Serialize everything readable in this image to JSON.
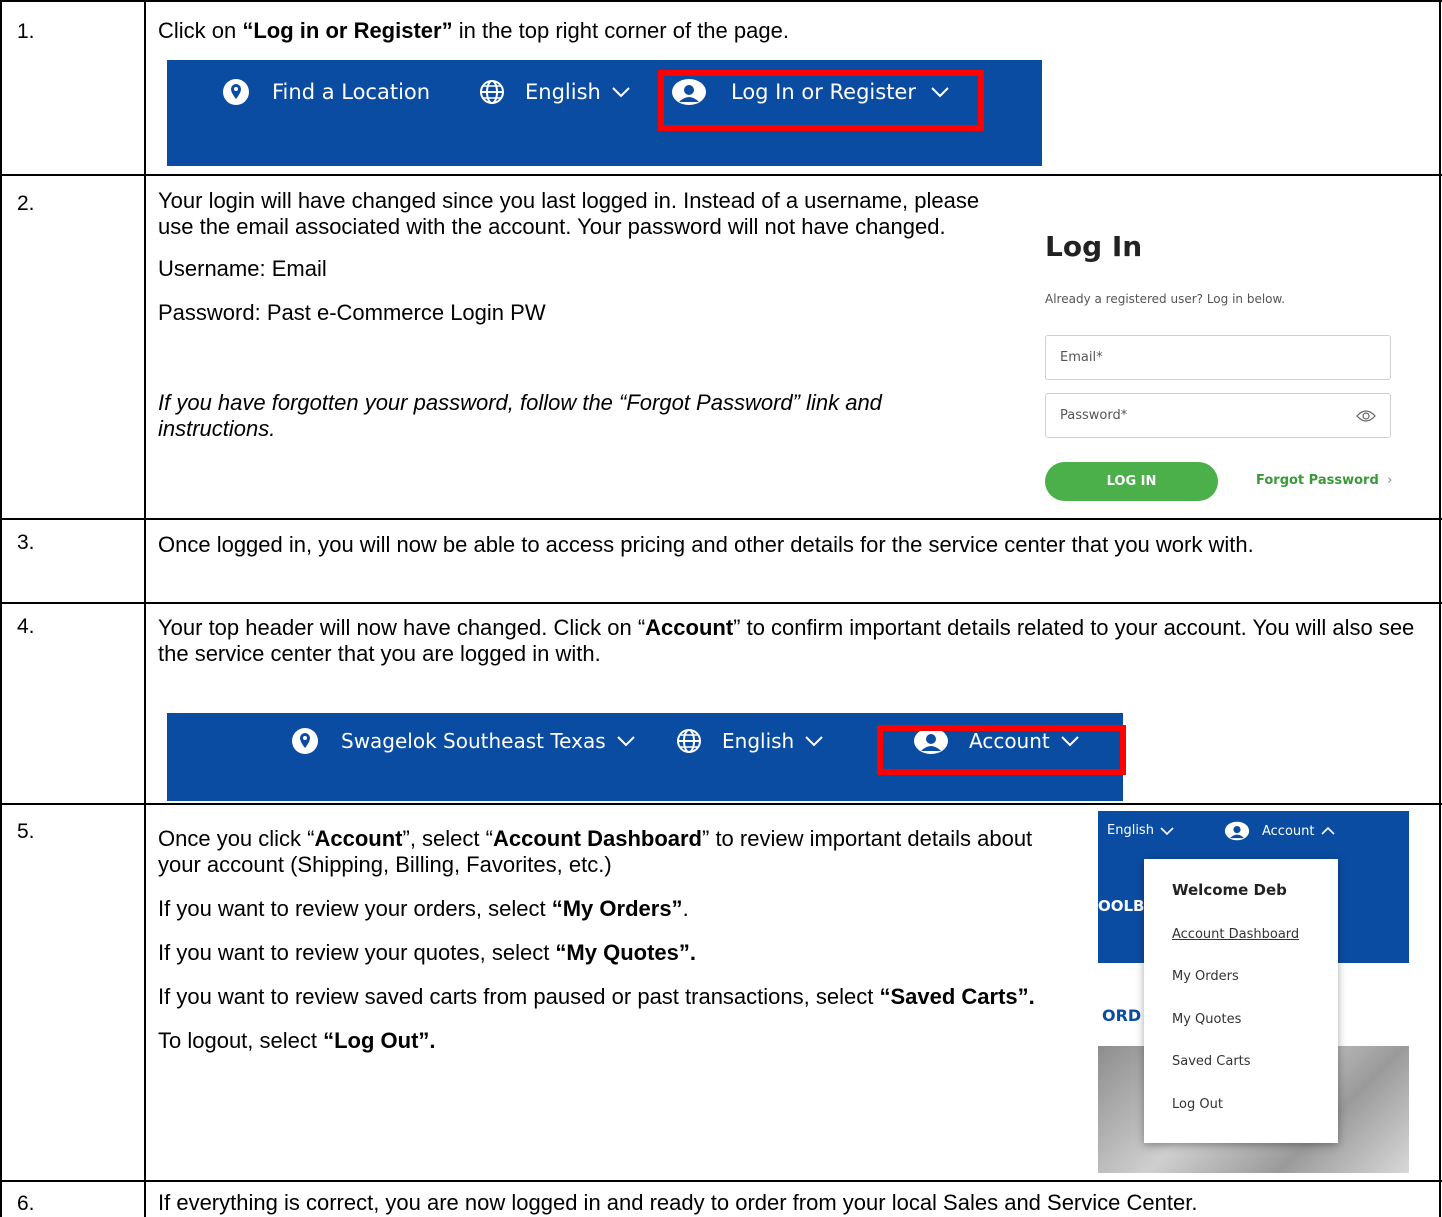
{
  "steps": [
    {
      "number": "1."
    },
    {
      "number": "2."
    },
    {
      "number": "3."
    },
    {
      "number": "4."
    },
    {
      "number": "5."
    },
    {
      "number": "6."
    }
  ],
  "step1": {
    "text_pre": "Click on ",
    "text_bold": "“Log in or Register”",
    "text_post": " in the top right corner of the page.",
    "nav": {
      "find_location": "Find a Location",
      "language": "English",
      "login": "Log In or Register"
    }
  },
  "step2": {
    "para1": "Your login will have changed since you last logged in. Instead of a username, please use the email associated with the account. Your password will not have changed.",
    "username_line": "Username: Email",
    "password_line": "Password: Past e-Commerce Login PW",
    "forgot_note": "If you have forgotten your password, follow the “Forgot Password” link and instructions.",
    "login_form": {
      "title": "Log In",
      "subtitle": "Already a registered user? Log in below.",
      "email_placeholder": "Email*",
      "password_placeholder": "Password*",
      "login_button": "LOG IN",
      "forgot_link": "Forgot Password",
      "accent_color": "#4bb04a",
      "link_color": "#3a9a3a"
    }
  },
  "step3": {
    "text": "Once logged in, you will now be able to access pricing and other details for the service center that you work with."
  },
  "step4": {
    "text_pre": "Your top header will now have changed. Click on “",
    "text_bold": "Account",
    "text_post": "” to confirm important details related to your account. You will also see the service center that you are logged in with.",
    "nav": {
      "location": "Swagelok Southeast Texas",
      "language": "English",
      "account": "Account"
    }
  },
  "step5": {
    "line1_pre": "Once you click “",
    "line1_bold1": "Account",
    "line1_mid": "”, select “",
    "line1_bold2": "Account Dashboard",
    "line1_post": "” to review important details about your account (Shipping, Billing, Favorites, etc.)",
    "orders_pre": "If you want to review your orders, select ",
    "orders_bold": "“My Orders”",
    "orders_post": ".",
    "quotes_pre": "If you want to review your quotes, select ",
    "quotes_bold": "“My Quotes”.",
    "carts_pre": "If you want to review saved carts from paused or past transactions, select ",
    "carts_bold": "“Saved Carts”.",
    "logout_pre": "To logout, select ",
    "logout_bold": "“Log Out”.",
    "menu": {
      "language": "English",
      "account": "Account",
      "welcome": "Welcome Deb",
      "items": [
        "Account Dashboard",
        "My Orders",
        "My Quotes",
        "Saved Carts",
        "Log Out"
      ],
      "bg_fragment_1": "OOLB",
      "bg_fragment_2": "ORD"
    }
  },
  "step6": {
    "text": "If everything is correct, you are now logged in and ready to order from your local Sales and Service Center."
  },
  "colors": {
    "nav_blue": "#0b4ca3",
    "highlight_red": "#ff0000"
  }
}
